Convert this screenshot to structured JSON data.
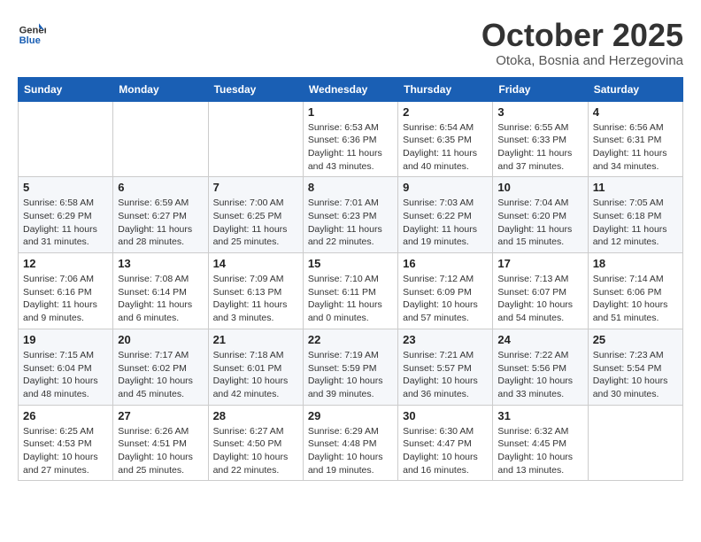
{
  "header": {
    "logo_line1": "General",
    "logo_line2": "Blue",
    "month": "October 2025",
    "location": "Otoka, Bosnia and Herzegovina"
  },
  "weekdays": [
    "Sunday",
    "Monday",
    "Tuesday",
    "Wednesday",
    "Thursday",
    "Friday",
    "Saturday"
  ],
  "weeks": [
    [
      {
        "day": "",
        "info": ""
      },
      {
        "day": "",
        "info": ""
      },
      {
        "day": "",
        "info": ""
      },
      {
        "day": "1",
        "info": "Sunrise: 6:53 AM\nSunset: 6:36 PM\nDaylight: 11 hours and 43 minutes."
      },
      {
        "day": "2",
        "info": "Sunrise: 6:54 AM\nSunset: 6:35 PM\nDaylight: 11 hours and 40 minutes."
      },
      {
        "day": "3",
        "info": "Sunrise: 6:55 AM\nSunset: 6:33 PM\nDaylight: 11 hours and 37 minutes."
      },
      {
        "day": "4",
        "info": "Sunrise: 6:56 AM\nSunset: 6:31 PM\nDaylight: 11 hours and 34 minutes."
      }
    ],
    [
      {
        "day": "5",
        "info": "Sunrise: 6:58 AM\nSunset: 6:29 PM\nDaylight: 11 hours and 31 minutes."
      },
      {
        "day": "6",
        "info": "Sunrise: 6:59 AM\nSunset: 6:27 PM\nDaylight: 11 hours and 28 minutes."
      },
      {
        "day": "7",
        "info": "Sunrise: 7:00 AM\nSunset: 6:25 PM\nDaylight: 11 hours and 25 minutes."
      },
      {
        "day": "8",
        "info": "Sunrise: 7:01 AM\nSunset: 6:23 PM\nDaylight: 11 hours and 22 minutes."
      },
      {
        "day": "9",
        "info": "Sunrise: 7:03 AM\nSunset: 6:22 PM\nDaylight: 11 hours and 19 minutes."
      },
      {
        "day": "10",
        "info": "Sunrise: 7:04 AM\nSunset: 6:20 PM\nDaylight: 11 hours and 15 minutes."
      },
      {
        "day": "11",
        "info": "Sunrise: 7:05 AM\nSunset: 6:18 PM\nDaylight: 11 hours and 12 minutes."
      }
    ],
    [
      {
        "day": "12",
        "info": "Sunrise: 7:06 AM\nSunset: 6:16 PM\nDaylight: 11 hours and 9 minutes."
      },
      {
        "day": "13",
        "info": "Sunrise: 7:08 AM\nSunset: 6:14 PM\nDaylight: 11 hours and 6 minutes."
      },
      {
        "day": "14",
        "info": "Sunrise: 7:09 AM\nSunset: 6:13 PM\nDaylight: 11 hours and 3 minutes."
      },
      {
        "day": "15",
        "info": "Sunrise: 7:10 AM\nSunset: 6:11 PM\nDaylight: 11 hours and 0 minutes."
      },
      {
        "day": "16",
        "info": "Sunrise: 7:12 AM\nSunset: 6:09 PM\nDaylight: 10 hours and 57 minutes."
      },
      {
        "day": "17",
        "info": "Sunrise: 7:13 AM\nSunset: 6:07 PM\nDaylight: 10 hours and 54 minutes."
      },
      {
        "day": "18",
        "info": "Sunrise: 7:14 AM\nSunset: 6:06 PM\nDaylight: 10 hours and 51 minutes."
      }
    ],
    [
      {
        "day": "19",
        "info": "Sunrise: 7:15 AM\nSunset: 6:04 PM\nDaylight: 10 hours and 48 minutes."
      },
      {
        "day": "20",
        "info": "Sunrise: 7:17 AM\nSunset: 6:02 PM\nDaylight: 10 hours and 45 minutes."
      },
      {
        "day": "21",
        "info": "Sunrise: 7:18 AM\nSunset: 6:01 PM\nDaylight: 10 hours and 42 minutes."
      },
      {
        "day": "22",
        "info": "Sunrise: 7:19 AM\nSunset: 5:59 PM\nDaylight: 10 hours and 39 minutes."
      },
      {
        "day": "23",
        "info": "Sunrise: 7:21 AM\nSunset: 5:57 PM\nDaylight: 10 hours and 36 minutes."
      },
      {
        "day": "24",
        "info": "Sunrise: 7:22 AM\nSunset: 5:56 PM\nDaylight: 10 hours and 33 minutes."
      },
      {
        "day": "25",
        "info": "Sunrise: 7:23 AM\nSunset: 5:54 PM\nDaylight: 10 hours and 30 minutes."
      }
    ],
    [
      {
        "day": "26",
        "info": "Sunrise: 6:25 AM\nSunset: 4:53 PM\nDaylight: 10 hours and 27 minutes."
      },
      {
        "day": "27",
        "info": "Sunrise: 6:26 AM\nSunset: 4:51 PM\nDaylight: 10 hours and 25 minutes."
      },
      {
        "day": "28",
        "info": "Sunrise: 6:27 AM\nSunset: 4:50 PM\nDaylight: 10 hours and 22 minutes."
      },
      {
        "day": "29",
        "info": "Sunrise: 6:29 AM\nSunset: 4:48 PM\nDaylight: 10 hours and 19 minutes."
      },
      {
        "day": "30",
        "info": "Sunrise: 6:30 AM\nSunset: 4:47 PM\nDaylight: 10 hours and 16 minutes."
      },
      {
        "day": "31",
        "info": "Sunrise: 6:32 AM\nSunset: 4:45 PM\nDaylight: 10 hours and 13 minutes."
      },
      {
        "day": "",
        "info": ""
      }
    ]
  ]
}
